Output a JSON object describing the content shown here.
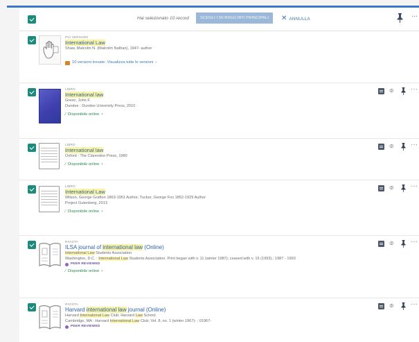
{
  "header": {
    "selected_count_text": "Hai selezionato 10 record",
    "select_all_label": "SCEGLI I 50 RISULTATI PRINCIPALI",
    "clear_label": "ANNULLA",
    "pin_icon": "pin-icon",
    "more_icon": "more-icon"
  },
  "colors": {
    "accent": "#3b78c4",
    "checkbox": "#1e8a7c",
    "title_link": "#2d62a8",
    "available": "#2c8a52",
    "peer_reviewed": "#6c4d9a",
    "highlight": "#f9f3a4"
  },
  "records": [
    {
      "type": "PIÙ VERSIONI",
      "title": "International Law",
      "lines": [
        "Shaw, Malcolm N. (Malcolm Nathan), 1947- author"
      ],
      "versions_text": "10 versioni trovate. Visualizza tutte le versioni",
      "thumb_icon": "multiple-versions-icon"
    },
    {
      "type": "LIBRO",
      "title": "International law",
      "lines": [
        "Green, John F.",
        "Dundee : Dundee University Press, 2010"
      ],
      "availability": "Disponibile online",
      "thumb_icon": "book-cover-image"
    },
    {
      "type": "LIBRO",
      "title": "International law",
      "lines": [
        "Oxford : The Clarendon Press, 1980"
      ],
      "availability": "Disponibile online",
      "thumb_icon": "book-icon"
    },
    {
      "type": "LIBRO",
      "title": "International Law",
      "lines": [
        "Wilson, George Grafton 1863-1951 Author; Tucker, George Fox 1852-1929 Author",
        "Project Gutenberg, 2013"
      ],
      "availability": "Disponibile online",
      "thumb_icon": "book-icon"
    },
    {
      "type": "RIVISTA",
      "title_prefix": "ILSA journal of ",
      "title_highlight": "international law",
      "title_suffix": " (Online)",
      "subline_highlight": "International Law",
      "subline_rest": " Students Association",
      "line_a": "Washington, D.C. : ",
      "line_a_hl": "International Law",
      "line_a_rest": " Students Association. Print began with v. 11 (winter 1987); ceased with v. 16 (1993).; 1987 - 1993",
      "peer_reviewed": "PEER REVIEWED",
      "availability": "Disponibile online",
      "thumb_icon": "journal-icon"
    },
    {
      "type": "RIVISTA",
      "title_prefix": "Harvard ",
      "title_highlight": "international law",
      "title_suffix": " journal (Online)",
      "subline_a": "Harvard ",
      "subline_hl": "International Law",
      "subline_b": " Club; Harvard ",
      "subline_hl2": "Law",
      "subline_c": " School",
      "line_a": "Cambridge, MA : Harvard ",
      "line_a_hl": "International Law",
      "line_a_rest": " Club; Vol. 8, no. 1 (winter 1967)- ; 01967-",
      "peer_reviewed": "PEER REVIEWED",
      "thumb_icon": "journal-icon"
    }
  ]
}
